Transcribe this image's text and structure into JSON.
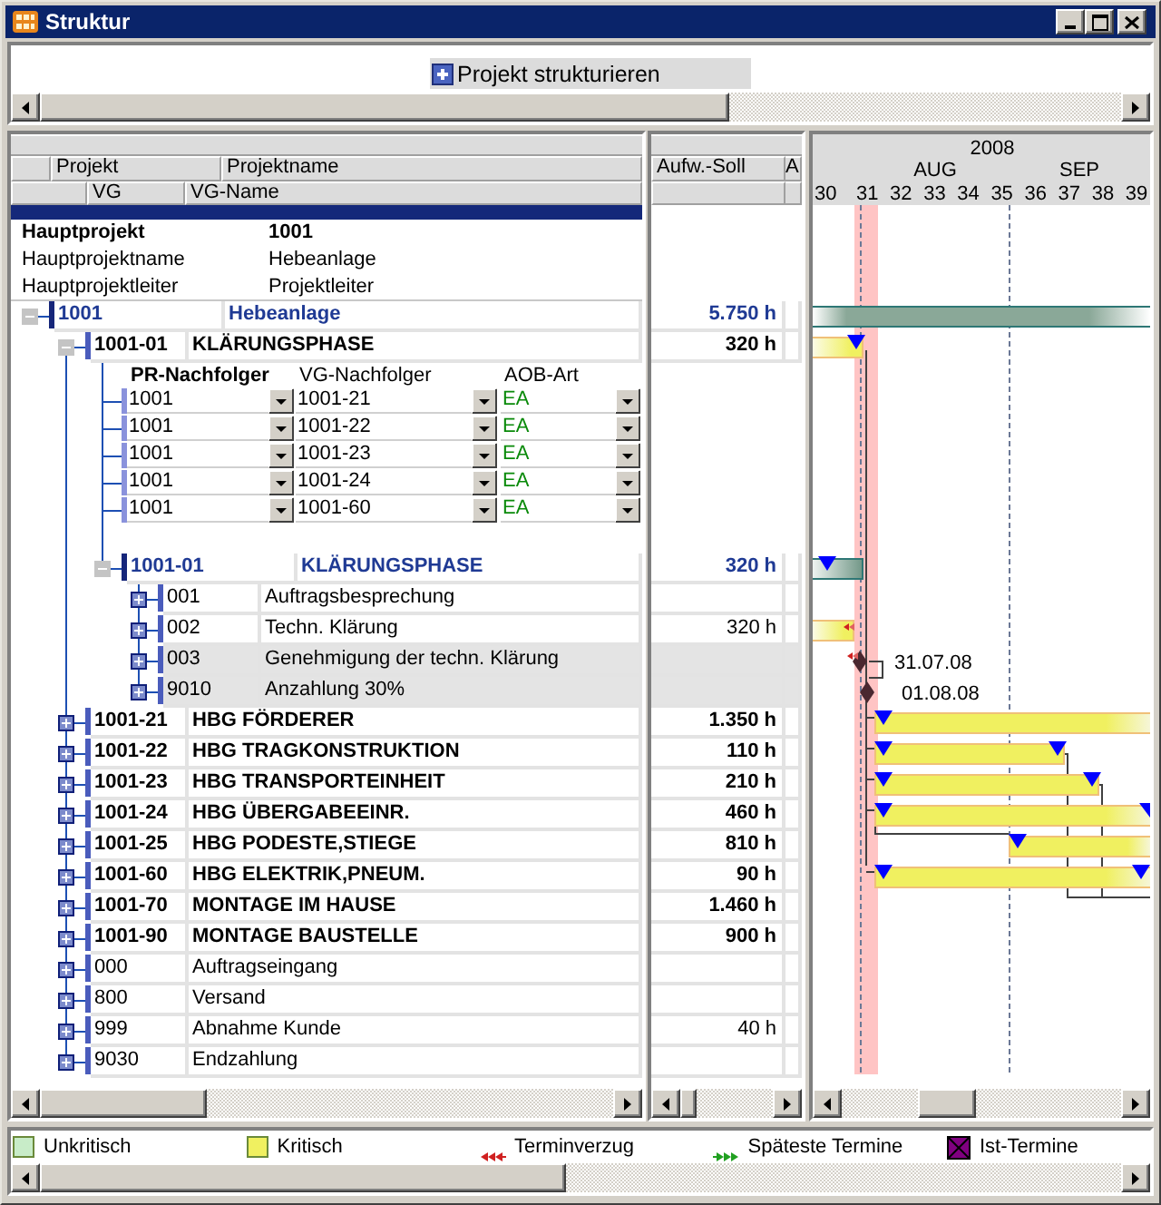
{
  "window": {
    "title": "Struktur"
  },
  "toolbar": {
    "button": "Projekt strukturieren"
  },
  "tree_header": [
    [
      "Projekt",
      "Projektname"
    ],
    [
      "VG",
      "VG-Name"
    ]
  ],
  "project_info": [
    {
      "label": "Hauptprojekt",
      "value": "1001",
      "bold": true
    },
    {
      "label": "Hauptprojektname",
      "value": "Hebeanlage",
      "bold": false
    },
    {
      "label": "Hauptprojektleiter",
      "value": "Projektleiter",
      "bold": false
    }
  ],
  "tree": [
    {
      "code": "1001",
      "name": "Hebeanlage",
      "kind": "project",
      "expanded": true,
      "shaded": false,
      "effort": "5.750 h",
      "bar": {
        "kind": "summary"
      },
      "children": [
        {
          "code": "1001-01",
          "name": "KLÄRUNGSPHASE",
          "kind": "summary",
          "expanded": true,
          "shaded": false,
          "effort": "320 h",
          "bar": {
            "kind": "critical"
          },
          "successors": {
            "columns": [
              {
                "label": "PR-Nachfolger",
                "bold": true
              },
              {
                "label": "VG-Nachfolger",
                "bold": false
              },
              {
                "label": "AOB-Art",
                "bold": false
              }
            ],
            "rows": [
              {
                "pr_successor": "1001",
                "vg_successor": "1001-21",
                "aob_type": "EA"
              },
              {
                "pr_successor": "1001",
                "vg_successor": "1001-22",
                "aob_type": "EA"
              },
              {
                "pr_successor": "1001",
                "vg_successor": "1001-23",
                "aob_type": "EA"
              },
              {
                "pr_successor": "1001",
                "vg_successor": "1001-24",
                "aob_type": "EA"
              },
              {
                "pr_successor": "1001",
                "vg_successor": "1001-60",
                "aob_type": "EA"
              }
            ]
          },
          "children": [
            {
              "code": "1001-01",
              "name": "KLÄRUNGSPHASE",
              "kind": "project",
              "expanded": true,
              "shaded": false,
              "effort": "320 h",
              "bar": {
                "kind": "summary"
              },
              "children": [
                {
                  "code": "001",
                  "name": "Auftragsbesprechung",
                  "kind": "task",
                  "expanded": false,
                  "shaded": false
                },
                {
                  "code": "002",
                  "name": "Techn. Klärung",
                  "kind": "task",
                  "expanded": false,
                  "shaded": false,
                  "effort": "320 h",
                  "bar": {
                    "kind": "critical"
                  }
                },
                {
                  "code": "003",
                  "name": "Genehmigung der techn. Klärung",
                  "kind": "task",
                  "expanded": false,
                  "shaded": true,
                  "bar": {
                    "kind": "milestone",
                    "date_label": "31.07.08"
                  }
                },
                {
                  "code": "9010",
                  "name": "Anzahlung 30%",
                  "kind": "task",
                  "expanded": false,
                  "shaded": true,
                  "bar": {
                    "kind": "milestone",
                    "date_label": "01.08.08"
                  }
                }
              ]
            }
          ]
        },
        {
          "code": "1001-21",
          "name": "HBG FÖRDERER",
          "kind": "summary",
          "expanded": false,
          "shaded": false,
          "effort": "1.350 h",
          "bar": {
            "kind": "critical"
          }
        },
        {
          "code": "1001-22",
          "name": "HBG TRAGKONSTRUKTION",
          "kind": "summary",
          "expanded": false,
          "shaded": false,
          "effort": "110 h",
          "bar": {
            "kind": "critical"
          }
        },
        {
          "code": "1001-23",
          "name": "HBG TRANSPORTEINHEIT",
          "kind": "summary",
          "expanded": false,
          "shaded": false,
          "effort": "210 h",
          "bar": {
            "kind": "critical"
          }
        },
        {
          "code": "1001-24",
          "name": "HBG ÜBERGABEEINR.",
          "kind": "summary",
          "expanded": false,
          "shaded": false,
          "effort": "460 h",
          "bar": {
            "kind": "critical"
          }
        },
        {
          "code": "1001-25",
          "name": "HBG PODESTE,STIEGE",
          "kind": "summary",
          "expanded": false,
          "shaded": false,
          "effort": "810 h",
          "bar": {
            "kind": "critical"
          }
        },
        {
          "code": "1001-60",
          "name": "HBG ELEKTRIK,PNEUM.",
          "kind": "summary",
          "expanded": false,
          "shaded": false,
          "effort": "90 h",
          "bar": {
            "kind": "critical"
          }
        },
        {
          "code": "1001-70",
          "name": "MONTAGE IM HAUSE",
          "kind": "summary",
          "expanded": false,
          "shaded": false,
          "effort": "1.460 h"
        },
        {
          "code": "1001-90",
          "name": "MONTAGE BAUSTELLE",
          "kind": "summary",
          "expanded": false,
          "shaded": false,
          "effort": "900 h"
        },
        {
          "code": "000",
          "name": "Auftragseingang",
          "kind": "task",
          "expanded": false,
          "shaded": false
        },
        {
          "code": "800",
          "name": "Versand",
          "kind": "task",
          "expanded": false,
          "shaded": false
        },
        {
          "code": "999",
          "name": "Abnahme Kunde",
          "kind": "task",
          "expanded": false,
          "shaded": false,
          "effort": "40 h"
        },
        {
          "code": "9030",
          "name": "Endzahlung",
          "kind": "task",
          "expanded": false,
          "shaded": false
        }
      ]
    }
  ],
  "effort_columns": [
    "Aufw.-Soll",
    "A"
  ],
  "timeline": {
    "year": "2008",
    "months": [
      "AUG",
      "SEP"
    ],
    "weeks": [
      "30",
      "31",
      "32",
      "33",
      "34",
      "35",
      "36",
      "37",
      "38",
      "39"
    ]
  },
  "legend": [
    {
      "label": "Unkritisch",
      "kind": "swatch",
      "color": "#c8ecc8"
    },
    {
      "label": "Kritisch",
      "kind": "swatch",
      "color": "#f0f060"
    },
    {
      "label": "Terminverzug",
      "kind": "delay",
      "color": "#d02020"
    },
    {
      "label": "Späteste Termine",
      "kind": "latest",
      "color": "#20a020"
    },
    {
      "label": "Ist-Termine",
      "kind": "actual",
      "color": "#800080"
    }
  ]
}
